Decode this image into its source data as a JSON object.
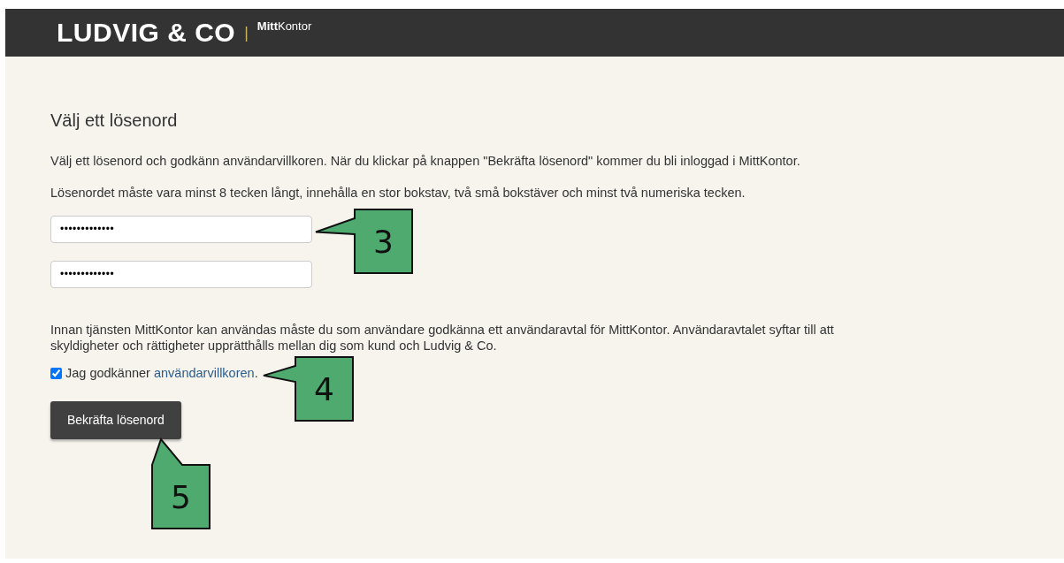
{
  "header": {
    "logo": "LUDVIG & CO",
    "separator": "|",
    "product": "**Mitt**Kontor"
  },
  "form": {
    "title": "Välj ett lösenord",
    "intro": [
      "Välj ett lösenord och godkänn användarvillkoren. När du klickar på knappen \"Bekräfta lösenord\" kommer du bli inloggad i MittKontor.",
      "Lösenordet måste vara minst 8 tecken långt, innehålla en stor bokstav, två små bokstäver och minst två numeriska tecken."
    ],
    "password_fields": [
      {
        "value": "•••••••••••••"
      },
      {
        "value": "•••••••••••••"
      }
    ],
    "agreement": "Innan tjänsten MittKontor kan användas måste du som användare godkänna ett användaravtal för MittKontor. Användaravtalet syftar till att skyldigheter och rättigheter upprätthålls mellan dig som kund och Ludvig & Co.",
    "consent": {
      "checked": true,
      "text_before": "Jag godkänner ",
      "link": "användarvillkoren",
      "text_after": "."
    },
    "submit": "Bekräfta lösenord"
  },
  "callouts": [
    {
      "number": "3",
      "kind": "field"
    },
    {
      "number": "4",
      "kind": "checkbox"
    },
    {
      "number": "5",
      "kind": "button"
    }
  ]
}
